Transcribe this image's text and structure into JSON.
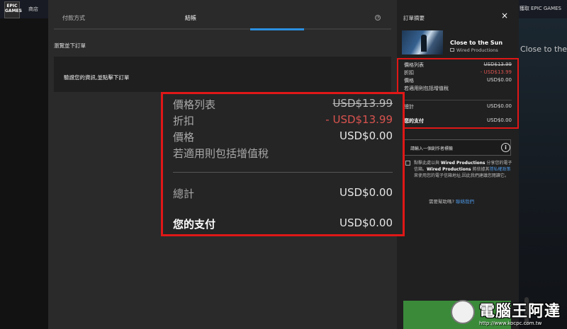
{
  "background": {
    "logo": "EPIC GAMES",
    "store_label": "商店",
    "epic_button": "獲取 EPIC GAMES",
    "right_text": "Close to the Sun"
  },
  "checkout": {
    "tabs": [
      {
        "label": "付款方式",
        "active": false
      },
      {
        "label": "結帳",
        "active": true
      }
    ],
    "review_title": "瀏覽並下訂單",
    "verify_text": "驗證您的資訊,並點擊下訂單"
  },
  "summary": {
    "title": "訂單摘要",
    "close_icon": "×",
    "game_title": "Close to the Sun",
    "publisher": "Wired Productions",
    "rows": {
      "list_price_label": "價格列表",
      "list_price_value": "USD$13.99",
      "discount_label": "折扣",
      "discount_value": "- USD$13.99",
      "price_label": "價格",
      "price_value": "USD$0.00",
      "vat_note": "若適用則包括增值稅",
      "subtotal_label": "總計",
      "subtotal_value": "USD$0.00",
      "you_pay_label": "您的支付",
      "you_pay_value": "USD$0.00"
    },
    "creator_placeholder": "請輸入一個創作者標籤",
    "consent": {
      "p1": "點擊此處以與 ",
      "publisher": "Wired Productions",
      "p2": " 分享您的電子信箱。",
      "publisher2": "Wired Productions",
      "p3": " 將依據其",
      "policy_link": "隱私權政策",
      "p4": "來使用您的電子信箱地址,因此我們建議您閱讀它。"
    },
    "help_text": "需要幫助嗎?",
    "help_link": "聯絡我們"
  },
  "watermark": {
    "text": "電腦王阿達",
    "url": "http://www.kocpc.com.tw"
  },
  "colors": {
    "accent_blue": "#2b8fe0",
    "highlight_red": "#e01717",
    "discount_red": "#d9534f",
    "order_green": "#3f9e3f"
  }
}
